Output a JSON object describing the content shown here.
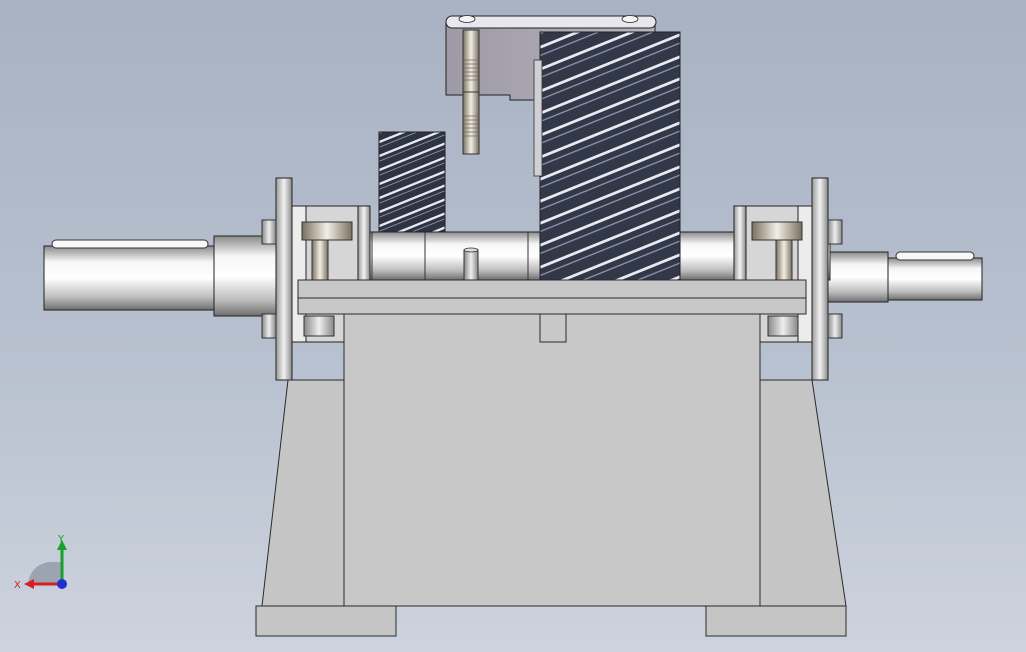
{
  "viewport": {
    "background_top": "#a8b2c3",
    "background_bottom": "#cdd3de"
  },
  "colors": {
    "housing_fill": "#c8c8c8",
    "housing_edge": "#2a2a2a",
    "steel_light": "#f4f4f4",
    "steel_dark": "#7c7c7c",
    "gear_dark": "#3a3f4e",
    "gear_line": "#e6e8f0"
  },
  "triad": {
    "x_label": "X",
    "y_label": "Y",
    "x_color": "#d42020",
    "y_color": "#17a02a",
    "z_color": "#2030d0"
  }
}
